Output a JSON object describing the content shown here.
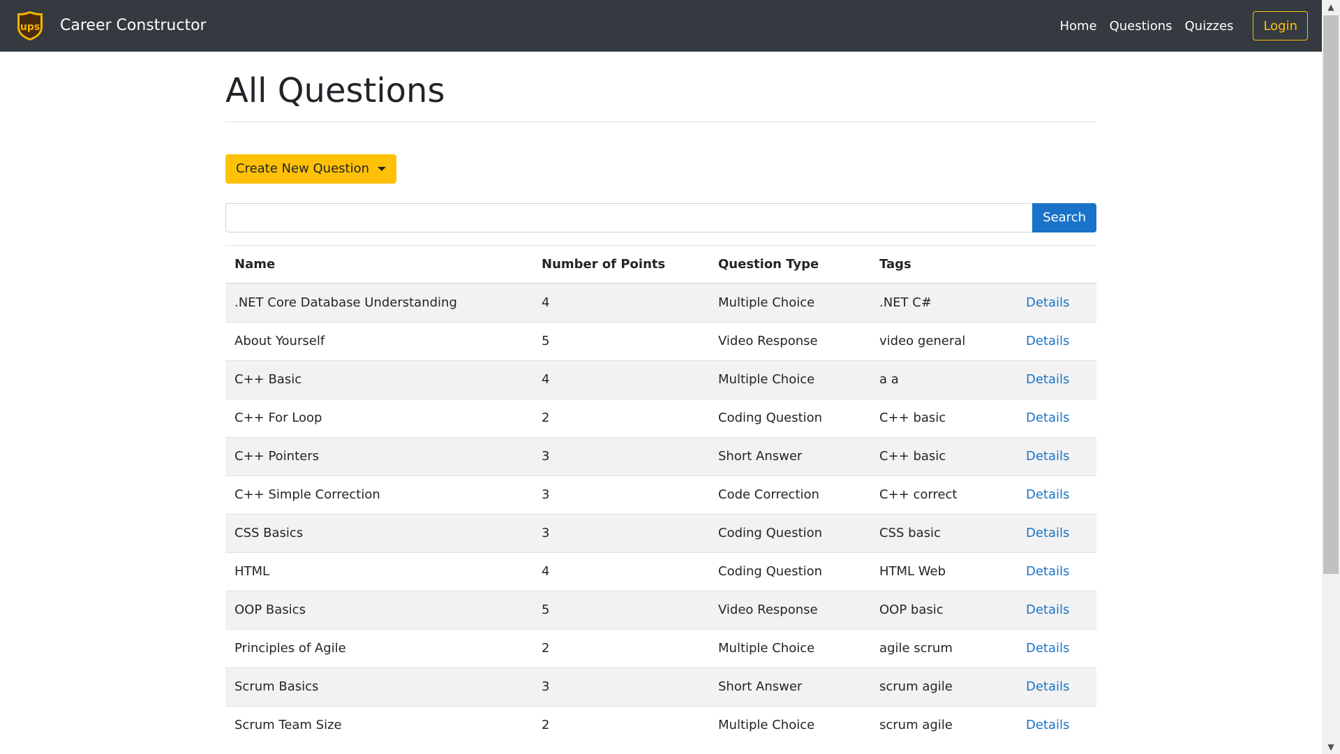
{
  "navbar": {
    "brand": "Career Constructor",
    "logo_text": "ups",
    "links": [
      "Home",
      "Questions",
      "Quizzes"
    ],
    "login_label": "Login"
  },
  "page": {
    "title": "All Questions",
    "create_button_label": "Create New Question",
    "search_value": "",
    "search_button_label": "Search"
  },
  "table": {
    "headers": [
      "Name",
      "Number of Points",
      "Question Type",
      "Tags"
    ],
    "rows": [
      {
        "name": ".NET Core Database Understanding",
        "points": "4",
        "type": "Multiple Choice",
        "tags": ".NET C#",
        "action": "Details"
      },
      {
        "name": "About Yourself",
        "points": "5",
        "type": "Video Response",
        "tags": "video general",
        "action": "Details"
      },
      {
        "name": "C++ Basic",
        "points": "4",
        "type": "Multiple Choice",
        "tags": "a a",
        "action": "Details"
      },
      {
        "name": "C++ For Loop",
        "points": "2",
        "type": "Coding Question",
        "tags": "C++ basic",
        "action": "Details"
      },
      {
        "name": "C++ Pointers",
        "points": "3",
        "type": "Short Answer",
        "tags": "C++ basic",
        "action": "Details"
      },
      {
        "name": "C++ Simple Correction",
        "points": "3",
        "type": "Code Correction",
        "tags": "C++ correct",
        "action": "Details"
      },
      {
        "name": "CSS Basics",
        "points": "3",
        "type": "Coding Question",
        "tags": "CSS basic",
        "action": "Details"
      },
      {
        "name": "HTML",
        "points": "4",
        "type": "Coding Question",
        "tags": "HTML Web",
        "action": "Details"
      },
      {
        "name": "OOP Basics",
        "points": "5",
        "type": "Video Response",
        "tags": "OOP basic",
        "action": "Details"
      },
      {
        "name": "Principles of Agile",
        "points": "2",
        "type": "Multiple Choice",
        "tags": "agile scrum",
        "action": "Details"
      },
      {
        "name": "Scrum Basics",
        "points": "3",
        "type": "Short Answer",
        "tags": "scrum agile",
        "action": "Details"
      },
      {
        "name": "Scrum Team Size",
        "points": "2",
        "type": "Multiple Choice",
        "tags": "scrum agile",
        "action": "Details"
      }
    ]
  },
  "colors": {
    "navbar_bg": "#343a40",
    "accent_yellow": "#ffc107",
    "link_blue": "#1a73c8",
    "logo_brown": "#4a2a10",
    "logo_gold": "#f5b400"
  }
}
